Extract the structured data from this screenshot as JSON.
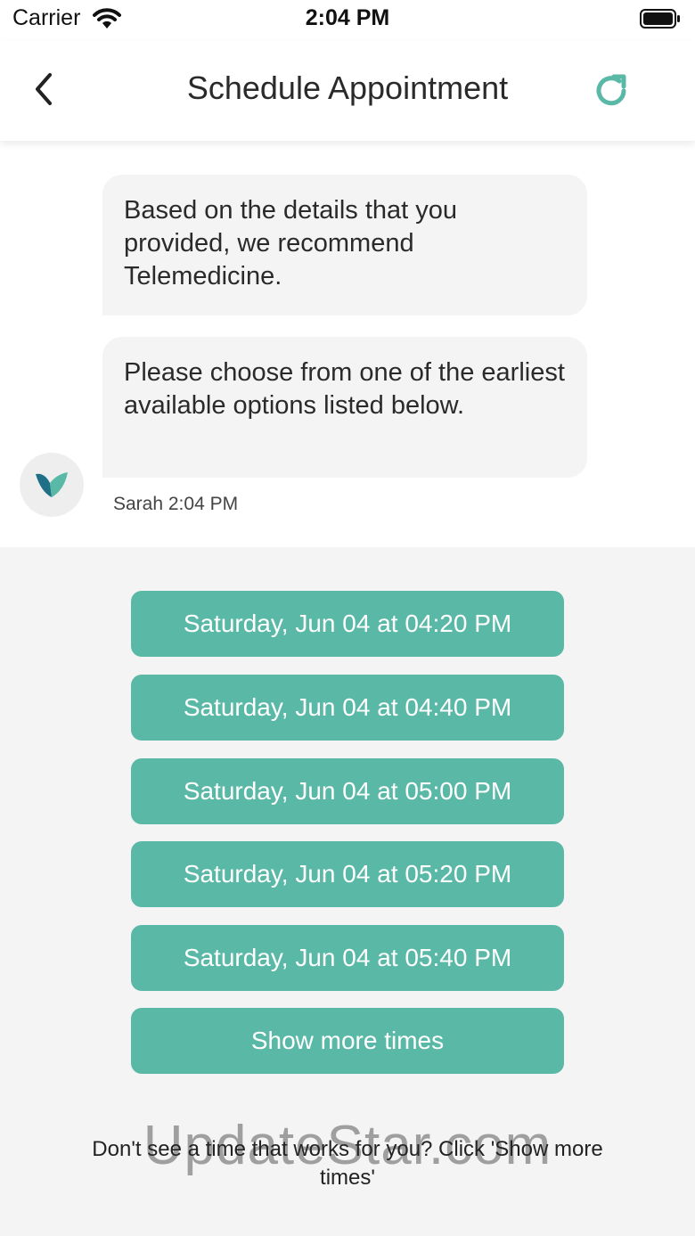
{
  "status_bar": {
    "carrier": "Carrier",
    "time": "2:04 PM"
  },
  "header": {
    "title": "Schedule Appointment",
    "back_icon": "chevron-left-icon",
    "refresh_icon": "refresh-icon",
    "accent_color": "#5ab8a7"
  },
  "chat": {
    "messages": [
      "Based on the details that you provided, we recommend Telemedicine.",
      "Please choose from one of the earliest available options listed below."
    ],
    "sender_name": "Sarah",
    "sender_time": "2:04 PM",
    "sender_label": "Sarah 2:04 PM",
    "avatar_icon": "brand-logo-icon"
  },
  "time_slots": [
    "Saturday, Jun 04 at 04:20 PM",
    "Saturday, Jun 04 at 04:40 PM",
    "Saturday, Jun 04 at 05:00 PM",
    "Saturday, Jun 04 at 05:20 PM",
    "Saturday, Jun 04 at 05:40 PM"
  ],
  "show_more_label": "Show more times",
  "hint_text": "Don't see a time that works for you? Click 'Show more times'",
  "watermark": "UpdateStar.com",
  "colors": {
    "slot_button": "#5ab8a7",
    "bubble": "#f4f4f4",
    "background": "#f4f4f4"
  }
}
